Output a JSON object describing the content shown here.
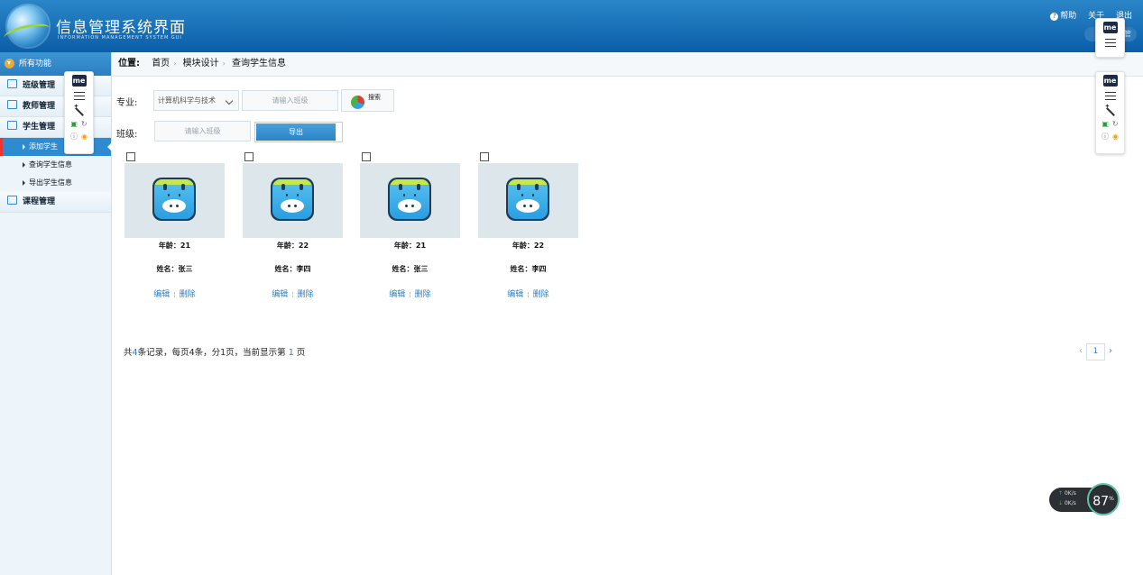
{
  "header": {
    "title": "信息管理系统界面",
    "subtitle": "INFORMATION MANAGEMENT SYSTEM GUI",
    "links": {
      "help": "帮助",
      "about": "关于",
      "logout": "退出"
    },
    "pill_text": "管"
  },
  "sidebar": {
    "all_functions": "所有功能",
    "groups": [
      {
        "label": "班级管理",
        "items": []
      },
      {
        "label": "教师管理",
        "items": []
      },
      {
        "label": "学生管理",
        "items": [
          "添加学生",
          "查询学生信息",
          "导出学生信息"
        ]
      },
      {
        "label": "课程管理",
        "items": []
      }
    ],
    "active_item": "添加学生"
  },
  "breadcrumb": {
    "label": "位置:",
    "items": [
      "首页",
      "模块设计",
      "查询学生信息"
    ]
  },
  "filters": {
    "major_label": "专业:",
    "major_value": "计算机科学与技术",
    "class_placeholder": "请输入班级",
    "search_label": "搜索",
    "class_label": "班级:",
    "class2_placeholder": "请输入班级",
    "export_label": "导出"
  },
  "cards": [
    {
      "age": "年龄：21",
      "name": "姓名：张三",
      "edit": "编辑",
      "delete": "删除"
    },
    {
      "age": "年龄：22",
      "name": "姓名：李四",
      "edit": "编辑",
      "delete": "删除"
    },
    {
      "age": "年龄：21",
      "name": "姓名：张三",
      "edit": "编辑",
      "delete": "删除"
    },
    {
      "age": "年龄：22",
      "name": "姓名：李四",
      "edit": "编辑",
      "delete": "删除"
    }
  ],
  "pagination": {
    "p1": "共",
    "total": "4",
    "p2": "条记录，每页4条，分1页，当前显示第",
    "current": "1",
    "p3": "页",
    "page_button": "1"
  },
  "extension": {
    "logo": "me"
  },
  "speed_widget": {
    "up": "0K/s",
    "down": "0K/s",
    "percent": "87",
    "percent_sign": "%"
  },
  "colors": {
    "accent": "#2e8bd0",
    "header": "#0b5ea8",
    "link": "#2f7fc5",
    "active_marker": "#e33"
  }
}
